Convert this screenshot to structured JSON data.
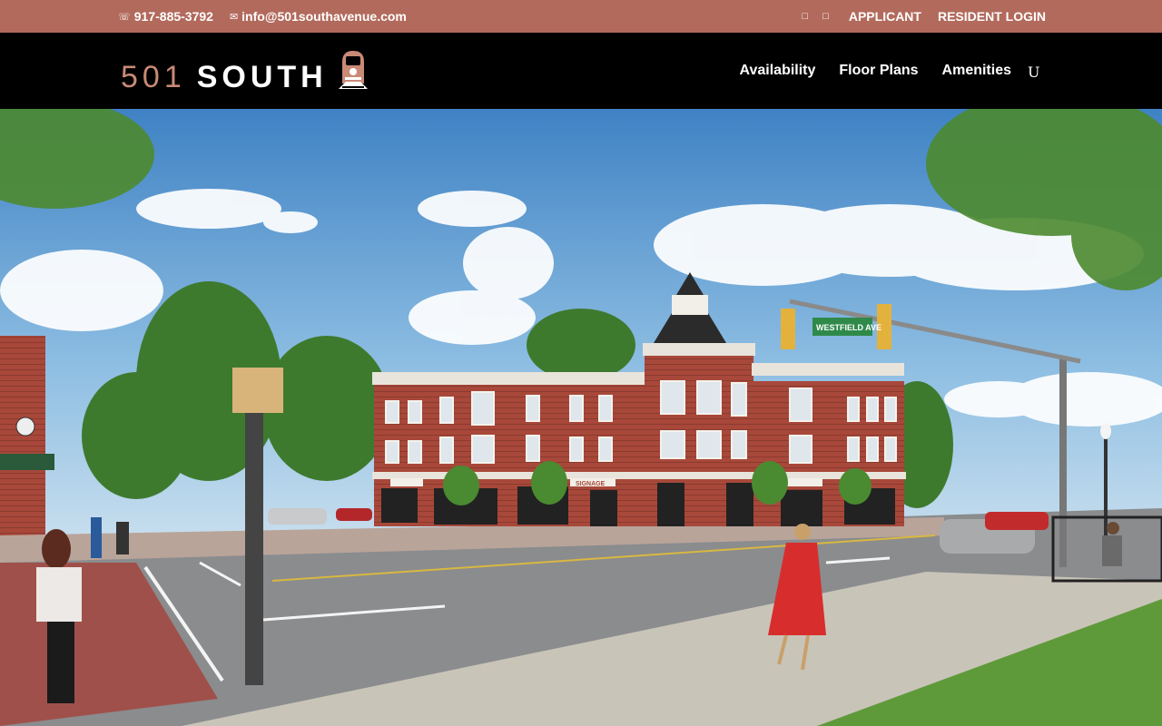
{
  "topbar": {
    "phone_icon": "phone-icon",
    "phone": "917-885-3792",
    "email_icon": "email-icon",
    "email": "info@501southavenue.com",
    "social_icons": [
      "facebook-icon",
      "instagram-icon"
    ],
    "applicant_label": "APPLICANT",
    "resident_login_label": "RESIDENT LOGIN",
    "background_color": "#b26a5c"
  },
  "header": {
    "logo_number": "501",
    "logo_word": "SOUTH",
    "logo_icon": "train-icon",
    "nav": [
      "Availability",
      "Floor Plans",
      "Amenities"
    ],
    "menu_toggle": "U",
    "accent_color": "#c98a76"
  },
  "hero": {
    "street_sign": "WESTFIELD AVE",
    "signage_text": "SIGNAGE"
  }
}
